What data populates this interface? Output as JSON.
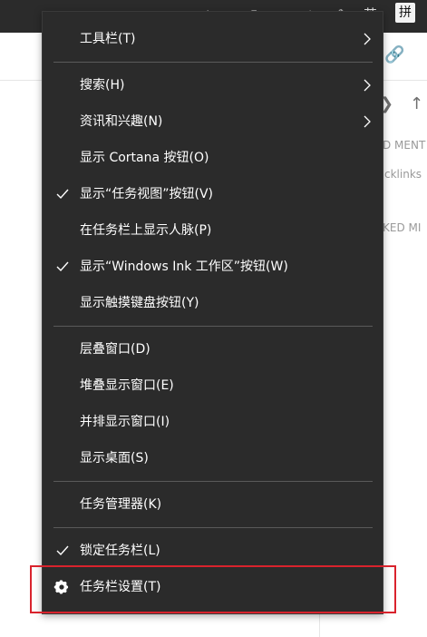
{
  "taskbar": {
    "tray_ime_label": "拼",
    "tray_lang_label": "英"
  },
  "background_app": {
    "label_1": "D MENT",
    "label_2": "cklinks",
    "label_3": "KED MI"
  },
  "menu": {
    "items": [
      {
        "label": "工具栏(T)",
        "checked": false,
        "submenu": true
      },
      {
        "label": "搜索(H)",
        "checked": false,
        "submenu": true
      },
      {
        "label": "资讯和兴趣(N)",
        "checked": false,
        "submenu": true
      },
      {
        "label": "显示 Cortana 按钮(O)",
        "checked": false,
        "submenu": false
      },
      {
        "label": "显示“任务视图”按钮(V)",
        "checked": true,
        "submenu": false
      },
      {
        "label": "在任务栏上显示人脉(P)",
        "checked": false,
        "submenu": false
      },
      {
        "label": "显示“Windows Ink 工作区”按钮(W)",
        "checked": true,
        "submenu": false
      },
      {
        "label": "显示触摸键盘按钮(Y)",
        "checked": false,
        "submenu": false
      },
      {
        "label": "层叠窗口(D)",
        "checked": false,
        "submenu": false
      },
      {
        "label": "堆叠显示窗口(E)",
        "checked": false,
        "submenu": false
      },
      {
        "label": "并排显示窗口(I)",
        "checked": false,
        "submenu": false
      },
      {
        "label": "显示桌面(S)",
        "checked": false,
        "submenu": false
      },
      {
        "label": "任务管理器(K)",
        "checked": false,
        "submenu": false
      },
      {
        "label": "锁定任务栏(L)",
        "checked": true,
        "submenu": false
      },
      {
        "label": "任务栏设置(T)",
        "checked": false,
        "submenu": false,
        "icon": "gear-icon",
        "highlighted": true
      }
    ]
  },
  "colors": {
    "menu_bg": "#2b2b2b",
    "menu_text": "#ffffff",
    "separator": "#5a5a5a",
    "highlight_border": "#d9232d"
  }
}
